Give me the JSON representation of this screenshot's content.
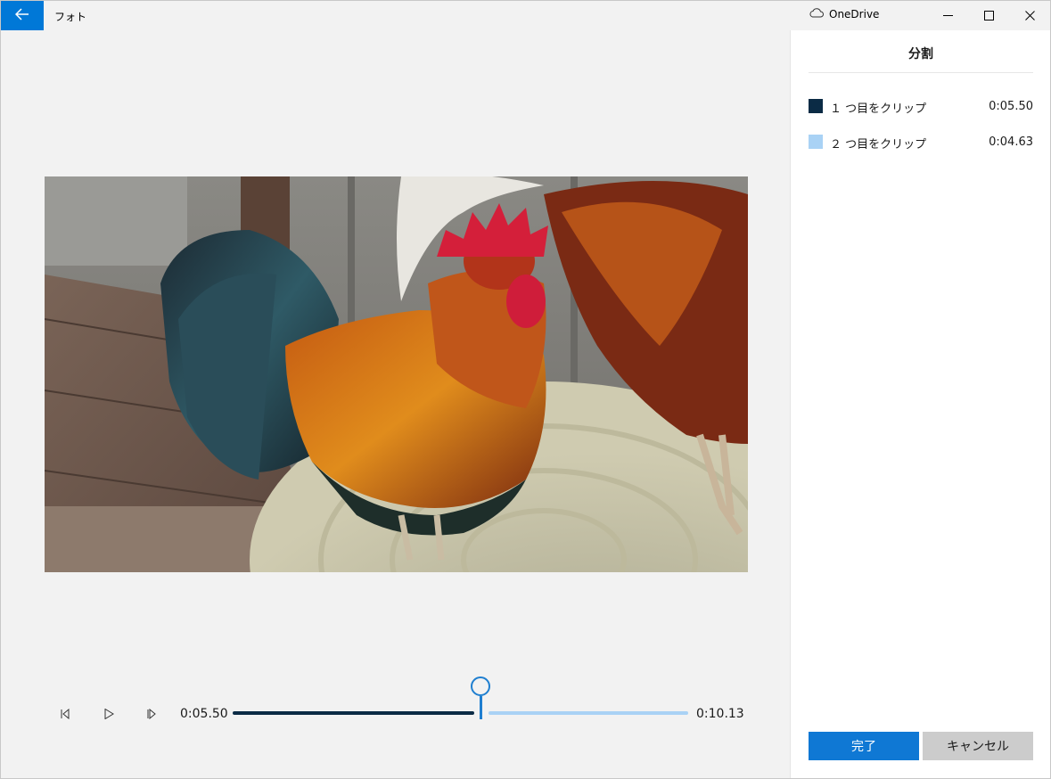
{
  "window": {
    "app_title": "フォト",
    "cloud_label": "OneDrive"
  },
  "icons": {
    "back": "back-arrow-icon",
    "cloud": "cloud-icon",
    "minimize": "minimize-icon",
    "maximize": "maximize-icon",
    "close": "close-icon",
    "prev_frame": "previous-frame-icon",
    "play": "play-icon",
    "next_frame": "next-frame-icon"
  },
  "player": {
    "current_time": "0:05.50",
    "total_time": "0:10.13",
    "split_position_fraction": 0.543
  },
  "panel": {
    "title": "分割",
    "clips": [
      {
        "label": "１ つ目をクリップ",
        "duration": "0:05.50",
        "color": "#0b2b45"
      },
      {
        "label": "２ つ目をクリップ",
        "duration": "0:04.63",
        "color": "#a9d2f5"
      }
    ],
    "done_label": "完了",
    "cancel_label": "キャンセル"
  },
  "colors": {
    "accent": "#0078d7",
    "clip1": "#0b2b45",
    "clip2": "#a9d2f5"
  }
}
